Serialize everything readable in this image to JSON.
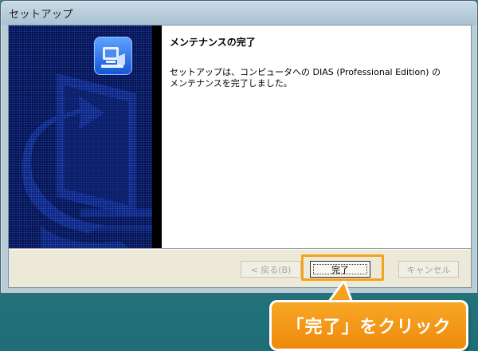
{
  "window": {
    "title": "セットアップ"
  },
  "content": {
    "heading": "メンテナンスの完了",
    "message_line1": "セットアップは、コンピュータへの DIAS (Professional Edition) の",
    "message_line2": "メンテナンスを完了しました。"
  },
  "buttons": {
    "back": "< 戻る(B)",
    "finish": "完了",
    "cancel": "キャンセル"
  },
  "annotation": {
    "callout": "「完了」をクリック"
  },
  "colors": {
    "accent_orange": "#f5a11c",
    "side_blue": "#1b3fae",
    "desktop_teal": "#2a7f88"
  },
  "icons": [
    "setup-computer-icon"
  ]
}
